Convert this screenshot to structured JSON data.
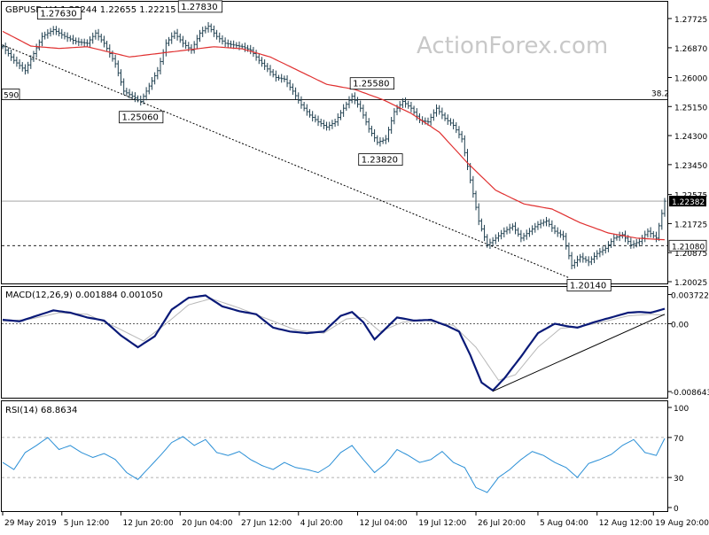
{
  "watermark": "ActionForex.com",
  "colors": {
    "background": "#ffffff",
    "frame": "#000000",
    "price_bars": "#1f3f4f",
    "ma_line": "#e03030",
    "macd_line": "#0a1a78",
    "macd_signal": "#b8b8b8",
    "rsi_line": "#2a8fd6",
    "guide_line": "#000000",
    "watermark": "#c8c8c8"
  },
  "chart_data": [
    {
      "type": "bar",
      "name": "price",
      "header": "GBPUSD,H4  1.22244 1.22655 1.22215 1.22382",
      "ylim": [
        1.20025,
        1.2806
      ],
      "y_ticks": [
        "1.27725",
        "1.26870",
        "1.26000",
        "1.25150",
        "1.24300",
        "1.23450",
        "1.22575",
        "1.21725",
        "1.20875",
        "1.20025"
      ],
      "last_price": "1.22382",
      "support_level": {
        "value": 1.2108,
        "label": "1.21080"
      },
      "fib_level": {
        "value": 1.2535,
        "label": "38.2",
        "left_label": "590"
      },
      "annotations": [
        {
          "label": "1.27630",
          "x": 13,
          "y": 1.2763
        },
        {
          "label": "1.25060",
          "x": 42,
          "y": 1.2506
        },
        {
          "label": "1.27830",
          "x": 63,
          "y": 1.2783
        },
        {
          "label": "1.25580",
          "x": 124,
          "y": 1.2558
        },
        {
          "label": "1.23820",
          "x": 127,
          "y": 1.2382
        },
        {
          "label": "1.20140",
          "x": 201,
          "y": 1.2014
        }
      ],
      "trendline": {
        "from": {
          "x": 0,
          "y": 1.2695
        },
        "to": {
          "x": 201,
          "y": 1.2014
        }
      },
      "ma_series": [
        [
          0,
          1.2735
        ],
        [
          10,
          1.2692
        ],
        [
          20,
          1.2685
        ],
        [
          30,
          1.269
        ],
        [
          45,
          1.266
        ],
        [
          60,
          1.2675
        ],
        [
          75,
          1.269
        ],
        [
          85,
          1.2684
        ],
        [
          95,
          1.266
        ],
        [
          105,
          1.262
        ],
        [
          115,
          1.258
        ],
        [
          125,
          1.2565
        ],
        [
          135,
          1.2535
        ],
        [
          145,
          1.2495
        ],
        [
          155,
          1.244
        ],
        [
          165,
          1.235
        ],
        [
          175,
          1.227
        ],
        [
          185,
          1.223
        ],
        [
          195,
          1.2215
        ],
        [
          205,
          1.2175
        ],
        [
          215,
          1.2145
        ],
        [
          225,
          1.213
        ],
        [
          235,
          1.2125
        ]
      ],
      "price_series": [
        [
          0,
          1.269
        ],
        [
          4,
          1.265
        ],
        [
          8,
          1.262
        ],
        [
          11,
          1.267
        ],
        [
          14,
          1.272
        ],
        [
          18,
          1.274
        ],
        [
          22,
          1.272
        ],
        [
          26,
          1.2705
        ],
        [
          30,
          1.27
        ],
        [
          33,
          1.273
        ],
        [
          36,
          1.27
        ],
        [
          40,
          1.264
        ],
        [
          43,
          1.256
        ],
        [
          46,
          1.2545
        ],
        [
          49,
          1.253
        ],
        [
          52,
          1.2575
        ],
        [
          55,
          1.262
        ],
        [
          58,
          1.27
        ],
        [
          61,
          1.273
        ],
        [
          64,
          1.27
        ],
        [
          67,
          1.268
        ],
        [
          70,
          1.273
        ],
        [
          73,
          1.275
        ],
        [
          76,
          1.272
        ],
        [
          79,
          1.27
        ],
        [
          82,
          1.2695
        ],
        [
          85,
          1.269
        ],
        [
          88,
          1.268
        ],
        [
          91,
          1.265
        ],
        [
          94,
          1.2625
        ],
        [
          97,
          1.26
        ],
        [
          100,
          1.2595
        ],
        [
          103,
          1.256
        ],
        [
          106,
          1.252
        ],
        [
          109,
          1.249
        ],
        [
          112,
          1.247
        ],
        [
          115,
          1.2455
        ],
        [
          118,
          1.247
        ],
        [
          121,
          1.251
        ],
        [
          124,
          1.2545
        ],
        [
          127,
          1.251
        ],
        [
          130,
          1.245
        ],
        [
          133,
          1.241
        ],
        [
          136,
          1.242
        ],
        [
          139,
          1.25
        ],
        [
          142,
          1.253
        ],
        [
          145,
          1.251
        ],
        [
          148,
          1.2475
        ],
        [
          151,
          1.247
        ],
        [
          154,
          1.251
        ],
        [
          157,
          1.248
        ],
        [
          160,
          1.246
        ],
        [
          163,
          1.242
        ],
        [
          166,
          1.23
        ],
        [
          169,
          1.218
        ],
        [
          172,
          1.211
        ],
        [
          175,
          1.213
        ],
        [
          178,
          1.215
        ],
        [
          181,
          1.2165
        ],
        [
          184,
          1.213
        ],
        [
          187,
          1.215
        ],
        [
          190,
          1.217
        ],
        [
          193,
          1.218
        ],
        [
          196,
          1.215
        ],
        [
          199,
          1.2135
        ],
        [
          202,
          1.205
        ],
        [
          205,
          1.2075
        ],
        [
          208,
          1.206
        ],
        [
          211,
          1.2085
        ],
        [
          214,
          1.21
        ],
        [
          217,
          1.213
        ],
        [
          220,
          1.214
        ],
        [
          223,
          1.211
        ],
        [
          226,
          1.212
        ],
        [
          229,
          1.215
        ],
        [
          232,
          1.213
        ],
        [
          235,
          1.2238
        ]
      ],
      "x_count": 236
    },
    {
      "type": "line",
      "name": "macd",
      "header": "MACD(12,26,9) 0.001884 0.001050",
      "ylim": [
        -0.0092,
        0.004
      ],
      "y_ticks": [
        "0.003722",
        "0.00",
        "-0.008643"
      ],
      "y_tick_values": [
        0.003722,
        0.0,
        -0.008643
      ],
      "macd_series": [
        [
          0,
          0.0005
        ],
        [
          6,
          0.0003
        ],
        [
          12,
          0.001
        ],
        [
          18,
          0.0017
        ],
        [
          24,
          0.0014
        ],
        [
          30,
          0.0008
        ],
        [
          36,
          0.0004
        ],
        [
          42,
          -0.0015
        ],
        [
          48,
          -0.003
        ],
        [
          54,
          -0.0016
        ],
        [
          60,
          0.0018
        ],
        [
          66,
          0.0033
        ],
        [
          72,
          0.0036
        ],
        [
          78,
          0.0022
        ],
        [
          84,
          0.0016
        ],
        [
          90,
          0.0012
        ],
        [
          96,
          -0.0005
        ],
        [
          102,
          -0.001
        ],
        [
          108,
          -0.0012
        ],
        [
          114,
          -0.001
        ],
        [
          120,
          0.001
        ],
        [
          124,
          0.0015
        ],
        [
          128,
          0.0002
        ],
        [
          132,
          -0.002
        ],
        [
          136,
          -0.0006
        ],
        [
          140,
          0.0008
        ],
        [
          146,
          0.0004
        ],
        [
          152,
          0.0005
        ],
        [
          158,
          -0.0003
        ],
        [
          162,
          -0.001
        ],
        [
          166,
          -0.004
        ],
        [
          170,
          -0.0075
        ],
        [
          174,
          -0.0085
        ],
        [
          178,
          -0.007
        ],
        [
          184,
          -0.0042
        ],
        [
          190,
          -0.0012
        ],
        [
          196,
          0.0
        ],
        [
          200,
          -0.0003
        ],
        [
          204,
          -0.0005
        ],
        [
          210,
          0.0002
        ],
        [
          216,
          0.0008
        ],
        [
          222,
          0.0014
        ],
        [
          226,
          0.0015
        ],
        [
          230,
          0.0014
        ],
        [
          235,
          0.0019
        ]
      ],
      "signal_series": [
        [
          0,
          0.0003
        ],
        [
          10,
          0.0006
        ],
        [
          20,
          0.0014
        ],
        [
          30,
          0.0012
        ],
        [
          40,
          -0.0004
        ],
        [
          50,
          -0.0022
        ],
        [
          58,
          0.0
        ],
        [
          66,
          0.0024
        ],
        [
          74,
          0.0032
        ],
        [
          84,
          0.002
        ],
        [
          94,
          0.0006
        ],
        [
          104,
          -0.0008
        ],
        [
          114,
          -0.0012
        ],
        [
          122,
          0.0006
        ],
        [
          128,
          0.0008
        ],
        [
          134,
          -0.001
        ],
        [
          142,
          0.0002
        ],
        [
          150,
          0.0004
        ],
        [
          160,
          -0.0002
        ],
        [
          168,
          -0.003
        ],
        [
          176,
          -0.0072
        ],
        [
          182,
          -0.0065
        ],
        [
          190,
          -0.003
        ],
        [
          198,
          -0.0006
        ],
        [
          206,
          -0.0003
        ],
        [
          214,
          0.0003
        ],
        [
          222,
          0.001
        ],
        [
          230,
          0.0012
        ],
        [
          235,
          0.0011
        ]
      ],
      "trendline": {
        "from": {
          "x": 174,
          "y": -0.0086
        },
        "to": {
          "x": 235,
          "y": 0.0012
        }
      }
    },
    {
      "type": "line",
      "name": "rsi",
      "header": "RSI(14) 68.8634",
      "ylim": [
        0,
        100
      ],
      "y_ticks": [
        "100",
        "70",
        "30",
        "0"
      ],
      "y_tick_values": [
        100,
        70,
        30,
        0
      ],
      "dashed_levels": [
        70,
        30
      ],
      "rsi_series": [
        [
          0,
          45
        ],
        [
          4,
          38
        ],
        [
          8,
          55
        ],
        [
          12,
          62
        ],
        [
          16,
          70
        ],
        [
          20,
          58
        ],
        [
          24,
          62
        ],
        [
          28,
          55
        ],
        [
          32,
          50
        ],
        [
          36,
          54
        ],
        [
          40,
          48
        ],
        [
          44,
          35
        ],
        [
          48,
          28
        ],
        [
          52,
          40
        ],
        [
          56,
          52
        ],
        [
          60,
          65
        ],
        [
          64,
          71
        ],
        [
          68,
          62
        ],
        [
          72,
          68
        ],
        [
          76,
          55
        ],
        [
          80,
          52
        ],
        [
          84,
          56
        ],
        [
          88,
          48
        ],
        [
          92,
          42
        ],
        [
          96,
          38
        ],
        [
          100,
          45
        ],
        [
          104,
          40
        ],
        [
          108,
          38
        ],
        [
          112,
          35
        ],
        [
          116,
          42
        ],
        [
          120,
          55
        ],
        [
          124,
          62
        ],
        [
          128,
          48
        ],
        [
          132,
          35
        ],
        [
          136,
          44
        ],
        [
          140,
          58
        ],
        [
          144,
          52
        ],
        [
          148,
          45
        ],
        [
          152,
          48
        ],
        [
          156,
          56
        ],
        [
          160,
          45
        ],
        [
          164,
          40
        ],
        [
          168,
          20
        ],
        [
          172,
          15
        ],
        [
          176,
          30
        ],
        [
          180,
          38
        ],
        [
          184,
          48
        ],
        [
          188,
          56
        ],
        [
          192,
          52
        ],
        [
          196,
          45
        ],
        [
          200,
          40
        ],
        [
          204,
          30
        ],
        [
          208,
          44
        ],
        [
          212,
          48
        ],
        [
          216,
          53
        ],
        [
          220,
          62
        ],
        [
          224,
          68
        ],
        [
          228,
          55
        ],
        [
          232,
          52
        ],
        [
          235,
          69
        ]
      ]
    }
  ],
  "x_axis": {
    "labels": [
      "29 May 2019",
      "5 Jun 12:00",
      "12 Jun 20:00",
      "20 Jun 04:00",
      "27 Jun 12:00",
      "4 Jul 20:00",
      "12 Jul 04:00",
      "19 Jul 12:00",
      "26 Jul 20:00",
      "5 Aug 04:00",
      "12 Aug 12:00",
      "19 Aug 20:00"
    ],
    "label_x": [
      0,
      21,
      42,
      63,
      84,
      105,
      126,
      147,
      168,
      190,
      211,
      231
    ]
  }
}
